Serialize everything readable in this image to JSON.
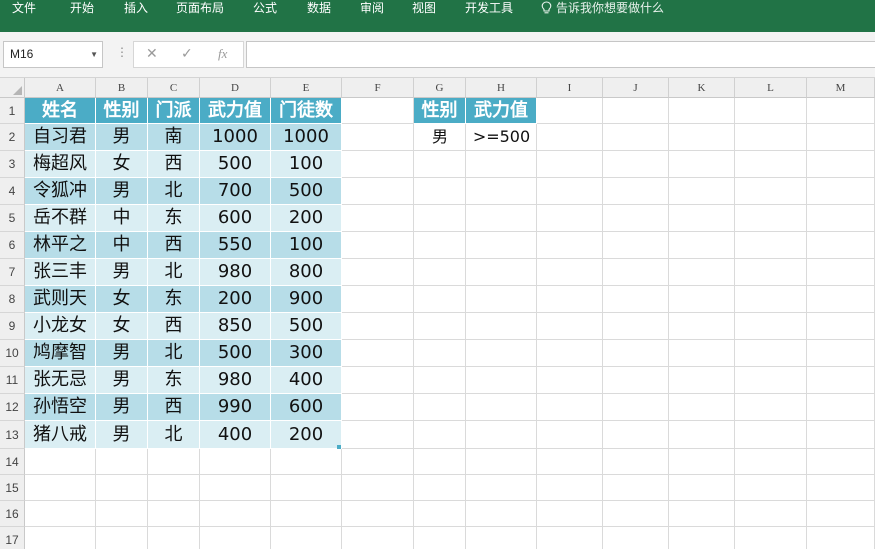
{
  "ribbon": {
    "tabs": [
      "文件",
      "开始",
      "插入",
      "页面布局",
      "公式",
      "数据",
      "审阅",
      "视图",
      "开发工具"
    ],
    "tell_me": "告诉我你想要做什么"
  },
  "formula_bar": {
    "name_box": "M16",
    "cancel_glyph": "✕",
    "enter_glyph": "✓",
    "fx_label": "fx",
    "formula_value": ""
  },
  "columns": [
    "A",
    "B",
    "C",
    "D",
    "E",
    "F",
    "G",
    "H",
    "I",
    "J",
    "K",
    "L",
    "M"
  ],
  "rows": [
    "1",
    "2",
    "3",
    "4",
    "5",
    "6",
    "7",
    "8",
    "9",
    "10",
    "11",
    "12",
    "13",
    "14",
    "15",
    "16",
    "17"
  ],
  "table": {
    "headers": [
      "姓名",
      "性别",
      "门派",
      "武力值",
      "门徒数"
    ],
    "data": [
      [
        "自习君",
        "男",
        "南",
        "1000",
        "1000"
      ],
      [
        "梅超风",
        "女",
        "西",
        "500",
        "100"
      ],
      [
        "令狐冲",
        "男",
        "北",
        "700",
        "500"
      ],
      [
        "岳不群",
        "中",
        "东",
        "600",
        "200"
      ],
      [
        "林平之",
        "中",
        "西",
        "550",
        "100"
      ],
      [
        "张三丰",
        "男",
        "北",
        "980",
        "800"
      ],
      [
        "武则天",
        "女",
        "东",
        "200",
        "900"
      ],
      [
        "小龙女",
        "女",
        "西",
        "850",
        "500"
      ],
      [
        "鸠摩智",
        "男",
        "北",
        "500",
        "300"
      ],
      [
        "张无忌",
        "男",
        "东",
        "980",
        "400"
      ],
      [
        "孙悟空",
        "男",
        "西",
        "990",
        "600"
      ],
      [
        "猪八戒",
        "男",
        "北",
        "400",
        "200"
      ]
    ]
  },
  "criteria": {
    "headers": [
      "性别",
      "武力值"
    ],
    "values": [
      "男",
      ">=500"
    ]
  },
  "colors": {
    "ribbon": "#217346",
    "table_header": "#4bacc6",
    "band_dark": "#b7dde8",
    "band_light": "#daeef3"
  }
}
